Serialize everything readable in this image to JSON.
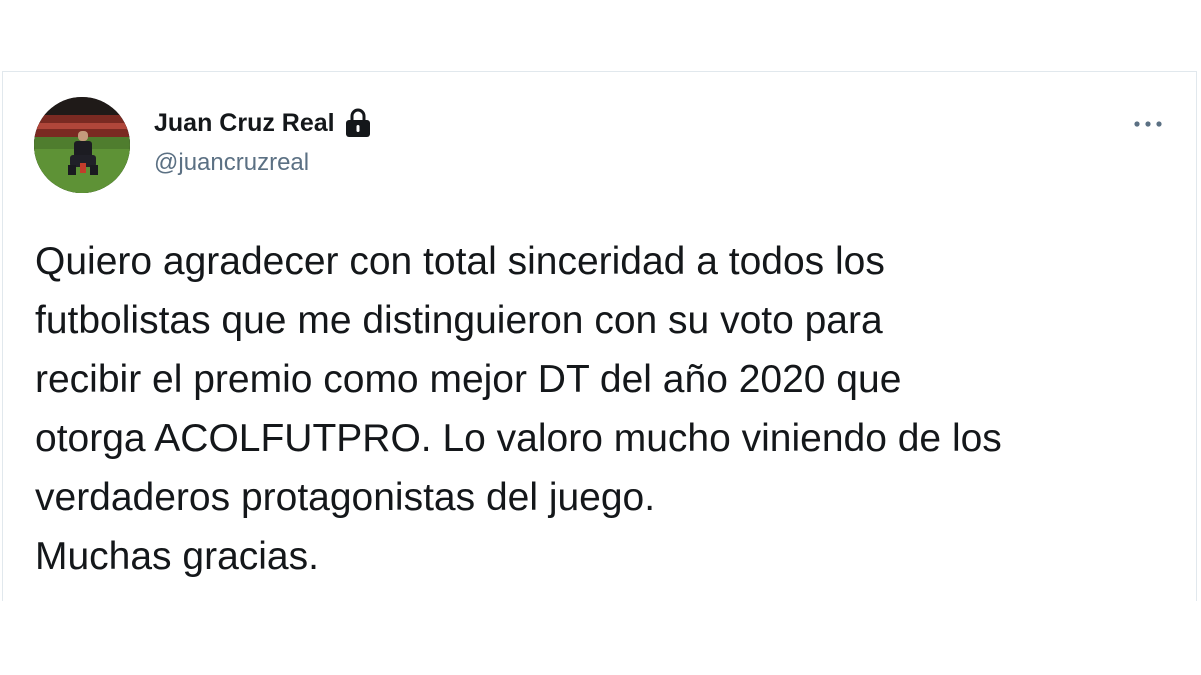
{
  "tweet": {
    "author": {
      "display_name": "Juan Cruz Real",
      "handle": "@juancruzreal",
      "protected_icon": "lock-icon"
    },
    "more_icon": "more-horizontal-icon",
    "text": "Quiero agradecer con total sinceridad a todos los\nfutbolistas que me distinguieron con su voto para\nrecibir el premio como mejor DT del año 2020 que\notorga ACOLFUTPRO. Lo valoro mucho viniendo de los\nverdaderos protagonistas del juego.\nMuchas gracias."
  },
  "colors": {
    "text_primary": "#14171a",
    "text_secondary": "#5b7083",
    "border": "#e1e8ed"
  }
}
